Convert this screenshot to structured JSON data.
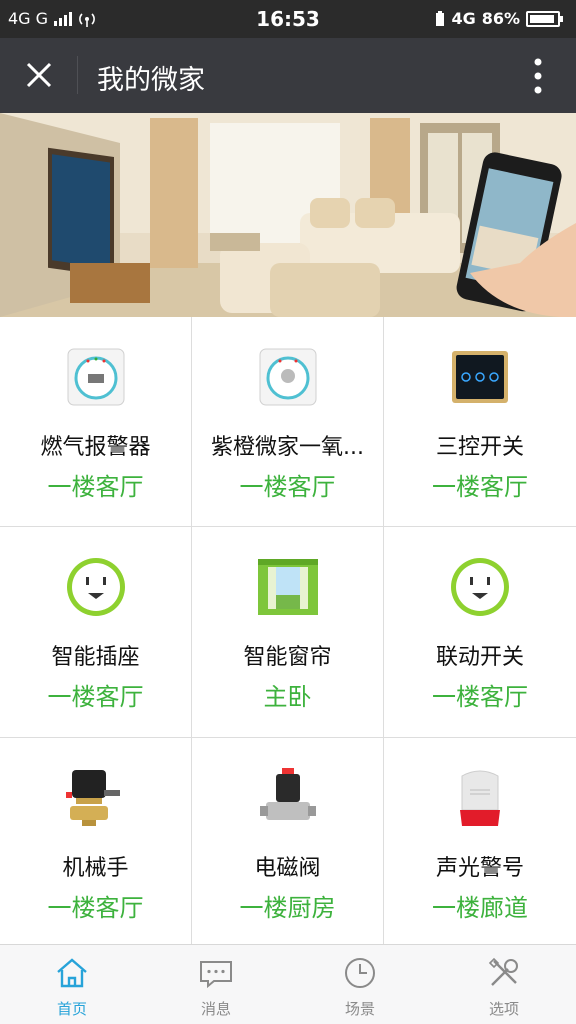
{
  "status_bar": {
    "left_signals": "4G  G",
    "time": "16:53",
    "network": "4G",
    "battery": "86%"
  },
  "nav": {
    "title": "我的微家"
  },
  "devices": [
    {
      "name": "燃气报警器",
      "room": "一楼客厅",
      "icon": "gas-alarm-icon"
    },
    {
      "name": "紫橙微家一氧...",
      "room": "一楼客厅",
      "icon": "co-alarm-icon"
    },
    {
      "name": "三控开关",
      "room": "一楼客厅",
      "icon": "triple-switch-icon"
    },
    {
      "name": "智能插座",
      "room": "一楼客厅",
      "icon": "smart-socket-icon"
    },
    {
      "name": "智能窗帘",
      "room": "主卧",
      "icon": "smart-curtain-icon"
    },
    {
      "name": "联动开关",
      "room": "一楼客厅",
      "icon": "linkage-switch-icon"
    },
    {
      "name": "机械手",
      "room": "一楼客厅",
      "icon": "valve-manipulator-icon"
    },
    {
      "name": "电磁阀",
      "room": "一楼厨房",
      "icon": "solenoid-valve-icon"
    },
    {
      "name": "声光警号",
      "room": "一楼廊道",
      "icon": "siren-icon"
    }
  ],
  "tabs": [
    {
      "label": "首页",
      "icon": "home-icon",
      "active": true
    },
    {
      "label": "消息",
      "icon": "message-icon",
      "active": false
    },
    {
      "label": "场景",
      "icon": "clock-icon",
      "active": false
    },
    {
      "label": "选项",
      "icon": "tools-icon",
      "active": false
    }
  ],
  "colors": {
    "accent_green": "#3db23d",
    "accent_blue": "#27a3d9",
    "nav_bg": "#393a3f"
  }
}
